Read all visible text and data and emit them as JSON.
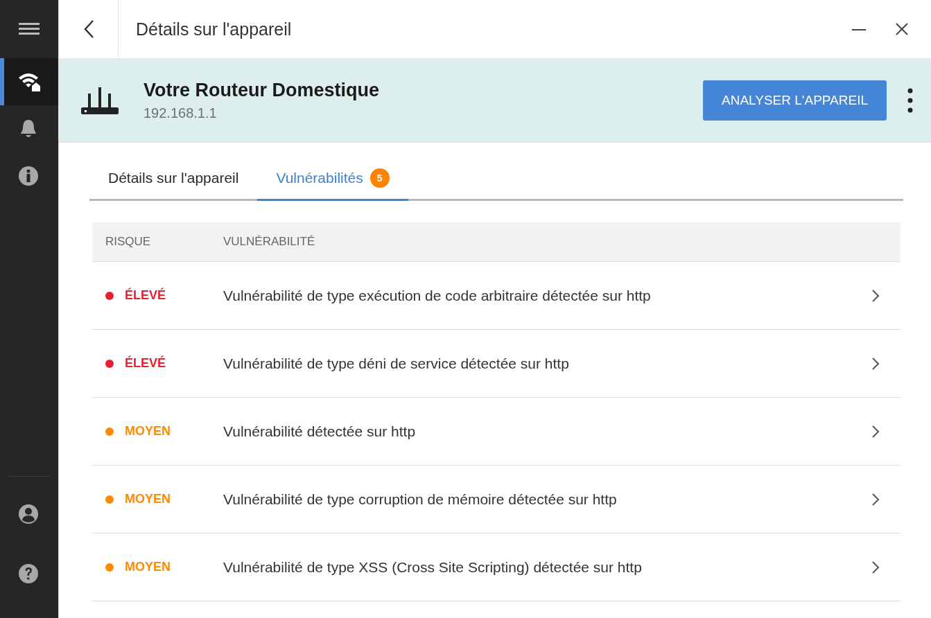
{
  "sidebar": {
    "items": [
      {
        "kind": "network",
        "selected": true
      },
      {
        "kind": "alerts",
        "selected": false
      },
      {
        "kind": "about",
        "selected": false
      }
    ],
    "bottom_items": [
      {
        "kind": "account",
        "selected": false
      },
      {
        "kind": "support",
        "selected": false
      }
    ]
  },
  "window": {
    "title": "Détails sur l'appareil"
  },
  "device": {
    "name": "Votre Routeur Domestique",
    "ip": "192.168.1.1",
    "action": "ANALYSER L'APPAREIL"
  },
  "tabs": [
    {
      "label": "Détails sur l'appareil",
      "selected": false
    },
    {
      "label": "Vulnérabilités",
      "selected": true,
      "badge": "5"
    }
  ],
  "table": {
    "columns": [
      "RISQUE",
      "VULNÉRABILITÉ"
    ],
    "rows": [
      {
        "risk": "ÉLEVÉ",
        "color": "#e8202e",
        "description": "Vulnérabilité de type exécution de code arbitraire détectée sur http"
      },
      {
        "risk": "ÉLEVÉ",
        "color": "#e8202e",
        "description": "Vulnérabilité de type déni de service détectée sur http"
      },
      {
        "risk": "MOYEN",
        "color": "#ff8a00",
        "description": "Vulnérabilité détectée sur http"
      },
      {
        "risk": "MOYEN",
        "color": "#ff8a00",
        "description": "Vulnérabilité de type corruption de mémoire détectée sur http"
      },
      {
        "risk": "MOYEN",
        "color": "#ff8a00",
        "description": "Vulnérabilité de type XSS (Cross Site Scripting) détectée sur http"
      }
    ]
  }
}
